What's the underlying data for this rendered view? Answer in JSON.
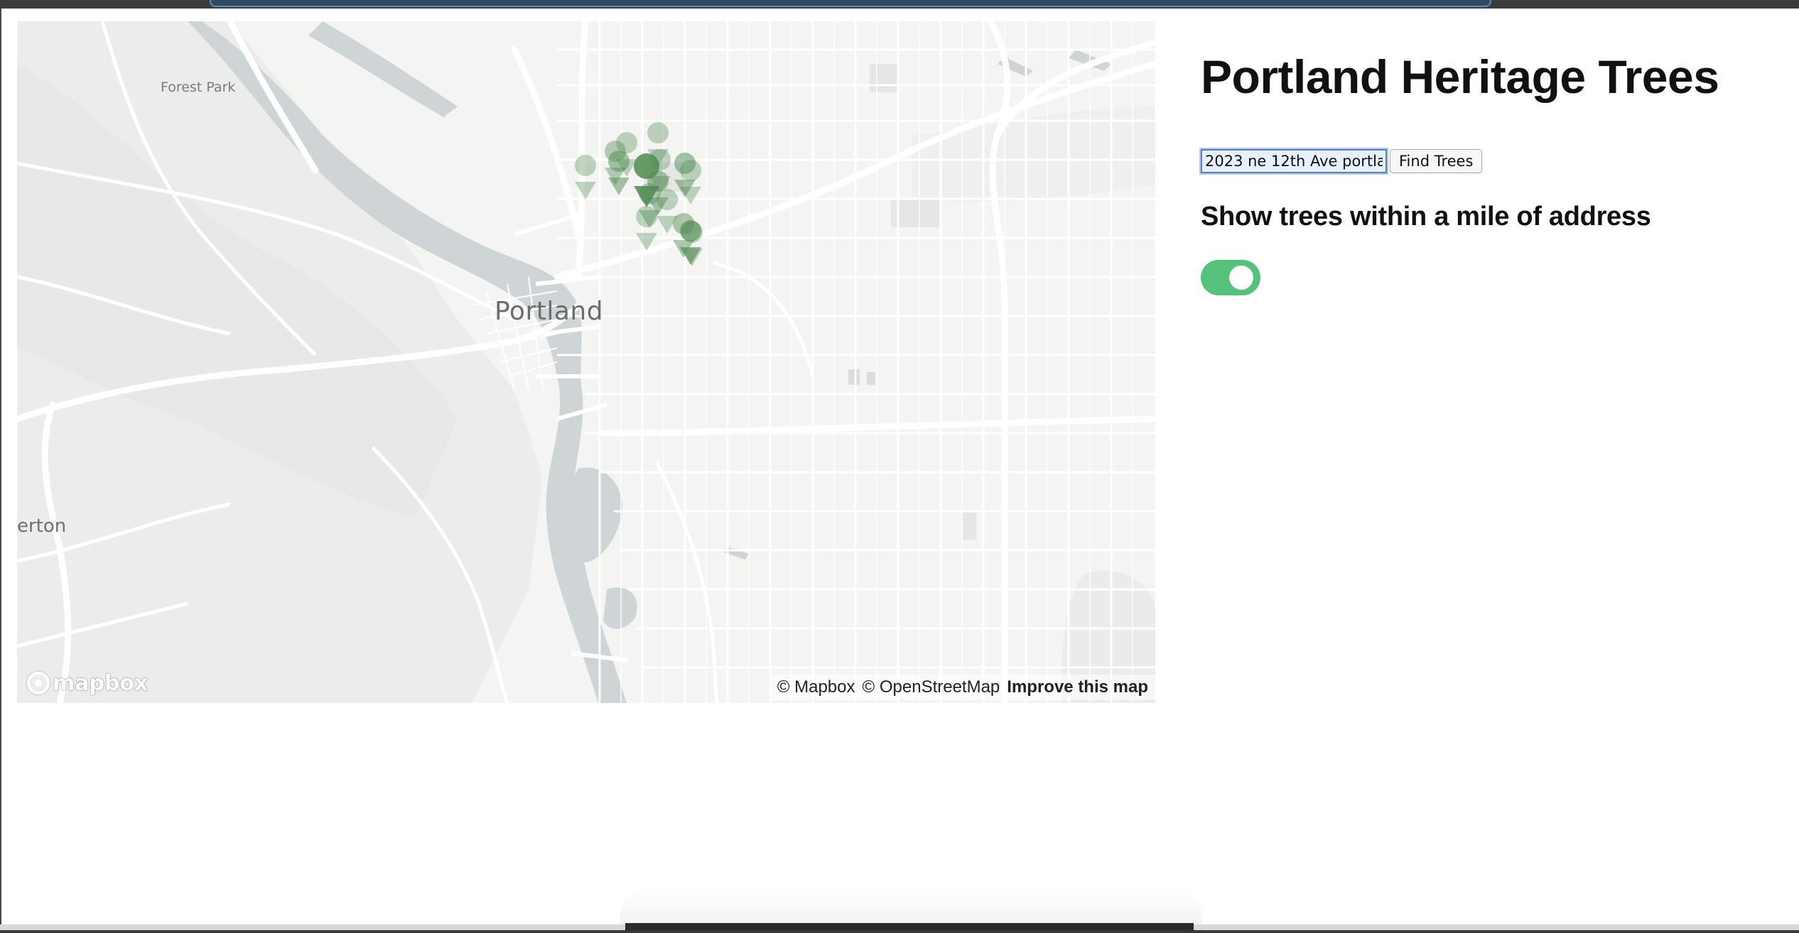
{
  "page": {
    "title": "Portland Heritage Trees",
    "search": {
      "input_value": "2023 ne 12th Ave portla",
      "button_label": "Find Trees"
    },
    "filter_label": "Show trees within a mile of address",
    "toggle_on": true,
    "accent_color": "#56c17a"
  },
  "map": {
    "labels": {
      "city": "Portland",
      "park": "Forest Park",
      "partial_place": "erton"
    },
    "logo_text": "mapbox",
    "attribution": {
      "mapbox": "© Mapbox",
      "osm": "© OpenStreetMap",
      "improve": "Improve this map"
    },
    "marker_color": "#4e8a4f",
    "icons": [
      "mapbox-logo-icon",
      "tree-marker-icon"
    ]
  }
}
